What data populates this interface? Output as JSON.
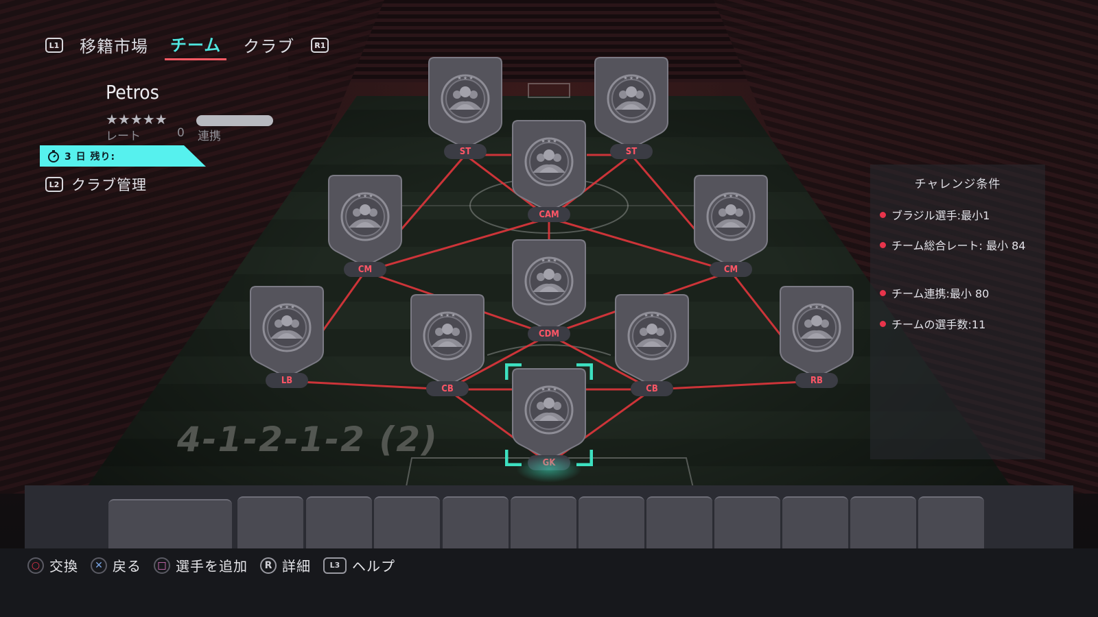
{
  "top_tabs": {
    "left_button": "L1",
    "right_button": "R1",
    "items": [
      {
        "label": "移籍市場",
        "active": false
      },
      {
        "label": "チーム",
        "active": true
      },
      {
        "label": "クラブ",
        "active": false
      }
    ]
  },
  "club": {
    "name": "Petros",
    "stars": "★★★★★",
    "rating_label": "レート",
    "rating_value": "0",
    "chemistry_label": "連携",
    "timer_text": "3 日 残り:",
    "management_button": "L2",
    "management_label": "クラブ管理"
  },
  "formation": {
    "name": "4-1-2-1-2 (2)",
    "positions": [
      "ST",
      "ST",
      "CAM",
      "CM",
      "CM",
      "CDM",
      "LB",
      "CB",
      "CB",
      "RB",
      "GK"
    ],
    "selected_position": "GK"
  },
  "challenge": {
    "title": "チャレンジ条件",
    "requirements": [
      "ブラジル選手:最小1",
      "チーム総合レート: 最小 84",
      "チーム連携:最小 80",
      "チームの選手数:11"
    ]
  },
  "controls": [
    {
      "icon": "circle-button-icon",
      "symbol": "○",
      "color": "#e8344b",
      "label": "交換"
    },
    {
      "icon": "cross-button-icon",
      "symbol": "✕",
      "color": "#7aa7e8",
      "label": "戻る"
    },
    {
      "icon": "square-button-icon",
      "symbol": "□",
      "color": "#e879c8",
      "label": "選手を追加"
    },
    {
      "icon": "right-stick-icon",
      "symbol": "R",
      "color": "#d0d0d6",
      "label": "詳細"
    },
    {
      "icon": "left-stick-icon",
      "symbol": "L3",
      "color": "#d0d0d6",
      "label": "ヘルプ"
    }
  ],
  "colors": {
    "accent": "#56f1ee",
    "position_label": "#ff5666",
    "chemistry_line": "#e0363c",
    "selection": "#3de0c0"
  }
}
